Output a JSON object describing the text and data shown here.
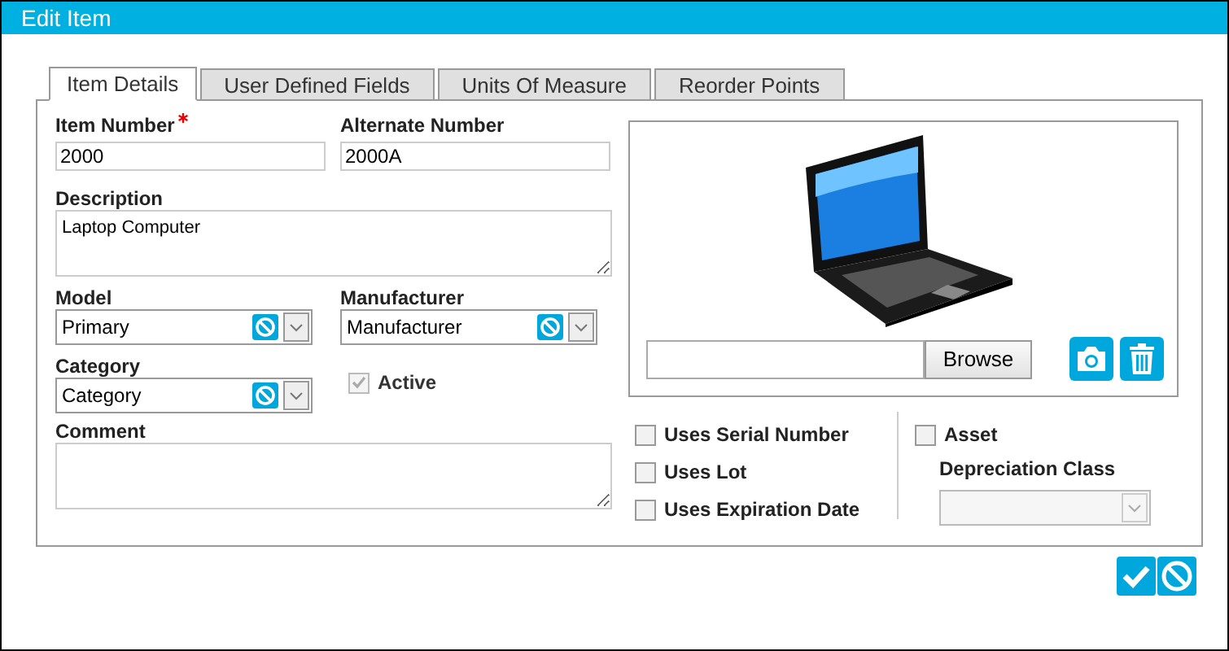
{
  "window": {
    "title": "Edit Item"
  },
  "tabs": [
    {
      "label": "Item Details",
      "selected": true
    },
    {
      "label": "User Defined Fields",
      "selected": false
    },
    {
      "label": "Units Of Measure",
      "selected": false
    },
    {
      "label": "Reorder Points",
      "selected": false
    }
  ],
  "item_number": {
    "label": "Item Number",
    "required": true,
    "value": "2000"
  },
  "alternate_number": {
    "label": "Alternate Number",
    "value": "2000A"
  },
  "description": {
    "label": "Description",
    "value": "Laptop Computer"
  },
  "model": {
    "label": "Model",
    "value": "Primary"
  },
  "manufacturer": {
    "label": "Manufacturer",
    "value": "Manufacturer"
  },
  "category": {
    "label": "Category",
    "value": "Category"
  },
  "active": {
    "label": "Active",
    "checked": true,
    "disabled": true
  },
  "comment": {
    "label": "Comment"
  },
  "image": {
    "kind": "picture",
    "browse_button": "Browse"
  },
  "flags": [
    {
      "label": "Uses Serial Number",
      "checked": false
    },
    {
      "label": "Uses Lot",
      "checked": false
    },
    {
      "label": "Uses Expiration Date",
      "checked": false
    }
  ],
  "asset": {
    "label": "Asset",
    "checked": false
  },
  "depreciation_class": {
    "label": "Depreciation Class"
  }
}
